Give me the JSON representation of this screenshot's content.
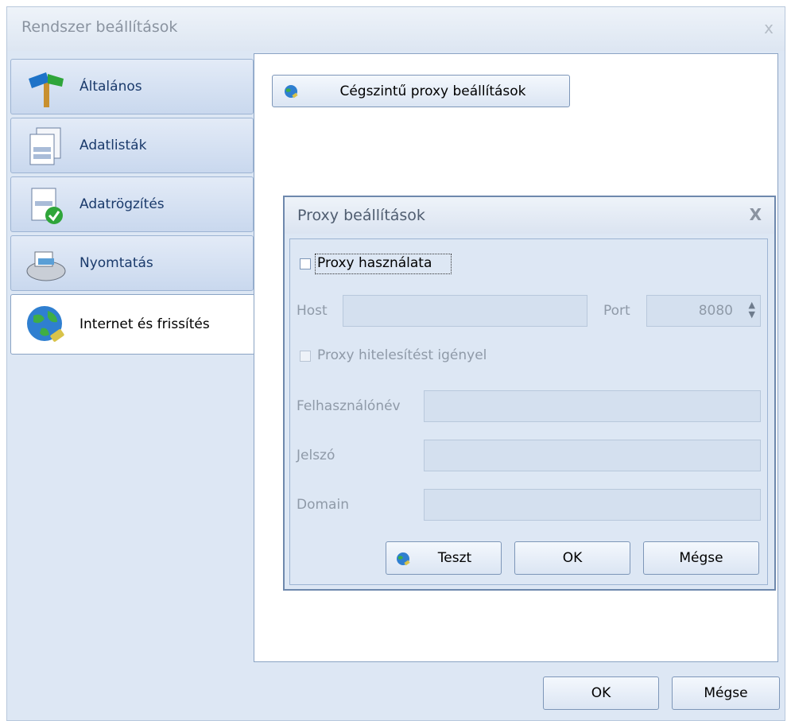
{
  "window": {
    "title": "Rendszer beállítások",
    "close_glyph": "x"
  },
  "sidebar": {
    "items": [
      {
        "label": "Általános",
        "icon": "signpost-icon"
      },
      {
        "label": "Adatlisták",
        "icon": "documents-icon"
      },
      {
        "label": "Adatrögzítés",
        "icon": "document-check-icon"
      },
      {
        "label": "Nyomtatás",
        "icon": "printer-icon"
      },
      {
        "label": "Internet és frissítés",
        "icon": "globe-plug-icon",
        "active": true
      }
    ]
  },
  "main": {
    "corporate_proxy_button": "Cégszintű proxy beállítások"
  },
  "dialog": {
    "title": "Proxy beállítások",
    "close_glyph": "X",
    "use_proxy_label": "Proxy használata",
    "host_label": "Host",
    "host_value": "",
    "port_label": "Port",
    "port_value": "8080",
    "auth_label": "Proxy hitelesítést igényel",
    "username_label": "Felhasználónév",
    "username_value": "",
    "password_label": "Jelszó",
    "password_value": "",
    "domain_label": "Domain",
    "domain_value": "",
    "test_button": "Teszt",
    "ok_button": "OK",
    "cancel_button": "Mégse"
  },
  "footer": {
    "ok_button": "OK",
    "cancel_button": "Mégse"
  },
  "colors": {
    "window_bg": "#dde7f4",
    "border": "#8aa3c4",
    "disabled_text": "#8f9aa8"
  }
}
